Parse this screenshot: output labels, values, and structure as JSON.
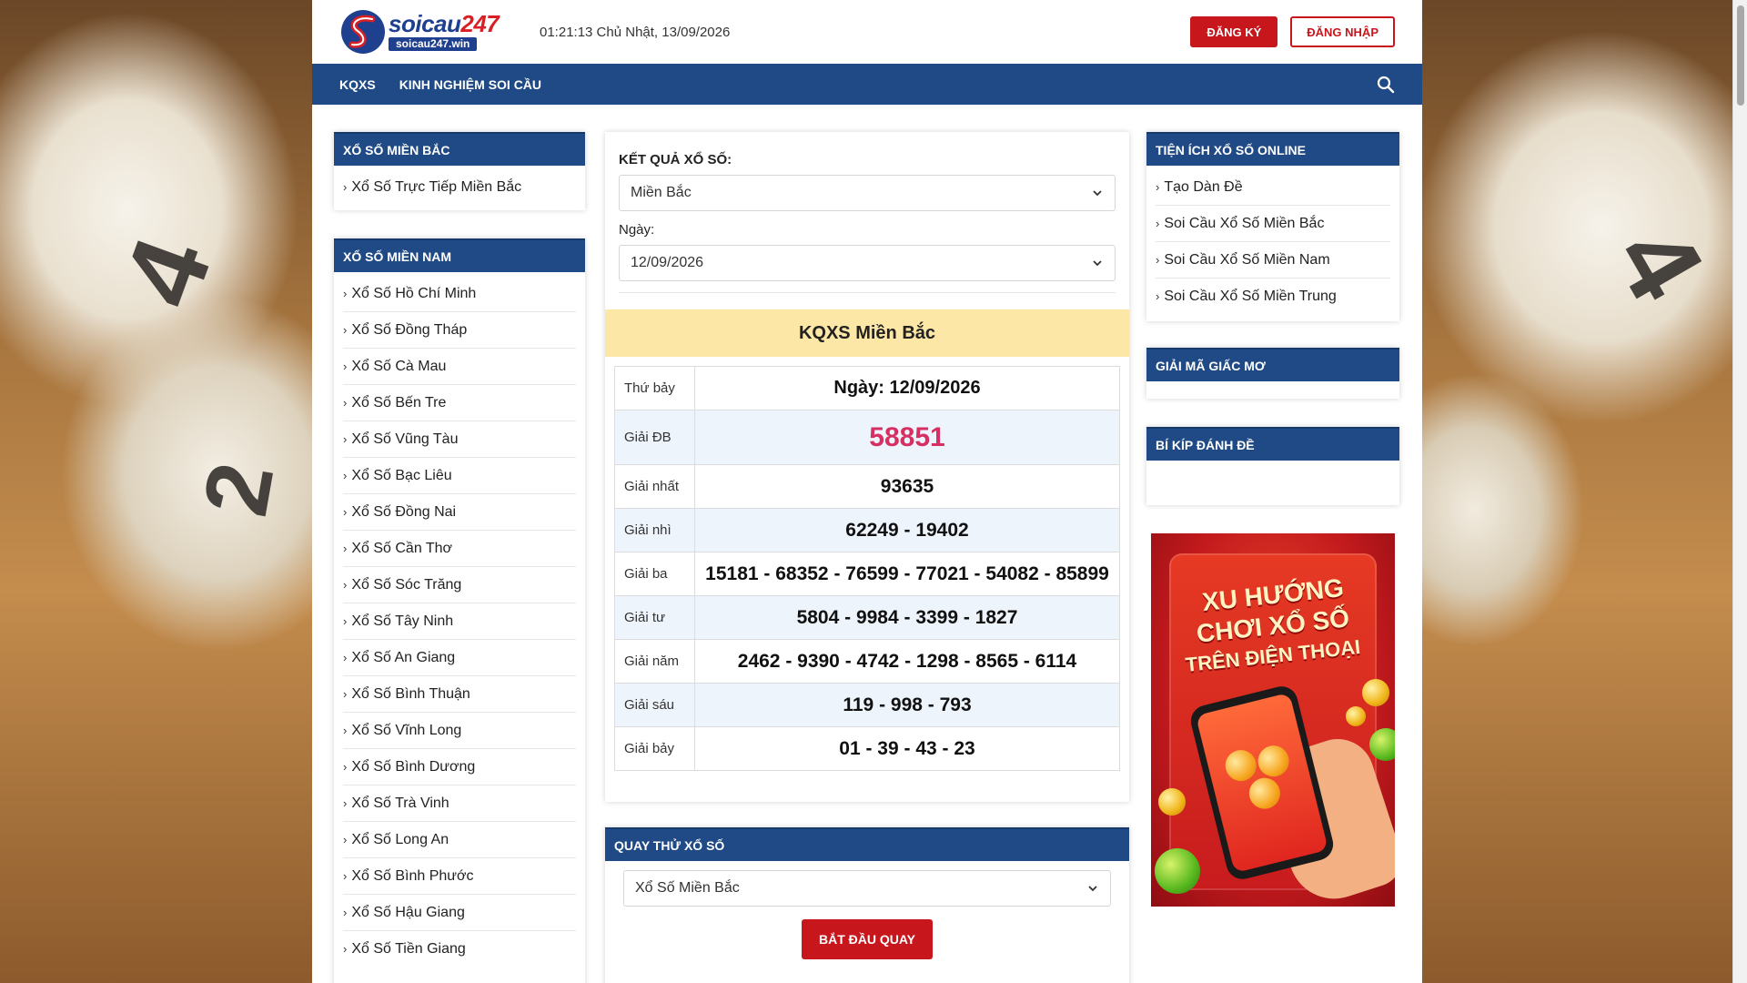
{
  "header": {
    "logo": {
      "name_part1": "soicau",
      "name_part2": "247",
      "url": "soicau247.win"
    },
    "datetime": "01:21:13 Chủ Nhật, 13/09/2026",
    "register_label": "ĐĂNG KÝ",
    "login_label": "ĐĂNG NHẬP"
  },
  "nav": {
    "items": [
      "KQXS",
      "KINH NGHIỆM SOI CẦU"
    ],
    "search_icon": "search-icon"
  },
  "left": {
    "bac": {
      "title": "XỔ SỐ MIỀN BẮC",
      "items": [
        "Xổ Số Trực Tiếp Miền Bắc"
      ]
    },
    "nam": {
      "title": "XỔ SỐ MIỀN NAM",
      "items": [
        "Xổ Số Hồ Chí Minh",
        "Xổ Số Đồng Tháp",
        "Xổ Số Cà Mau",
        "Xổ Số Bến Tre",
        "Xổ Số Vũng Tàu",
        "Xổ Số Bạc Liêu",
        "Xổ Số Đồng Nai",
        "Xổ Số Cần Thơ",
        "Xổ Số Sóc Trăng",
        "Xổ Số Tây Ninh",
        "Xổ Số An Giang",
        "Xổ Số Bình Thuận",
        "Xổ Số Vĩnh Long",
        "Xổ Số Bình Dương",
        "Xổ Số Trà Vinh",
        "Xổ Số Long An",
        "Xổ Số Bình Phước",
        "Xổ Số Hậu Giang",
        "Xổ Số Tiền Giang"
      ]
    }
  },
  "center": {
    "form": {
      "result_label": "KẾT QUẢ XỔ SỐ:",
      "region_value": "Miền Bắc",
      "date_label": "Ngày:",
      "date_value": "12/09/2026"
    },
    "result_title": "KQXS Miền Bắc",
    "table": {
      "day": "Thứ bảy",
      "date": "Ngày: 12/09/2026",
      "rows": [
        {
          "label": "Giải ĐB",
          "value": "58851"
        },
        {
          "label": "Giải nhất",
          "value": "93635"
        },
        {
          "label": "Giải nhì",
          "value": "62249 - 19402"
        },
        {
          "label": "Giải ba",
          "value": "15181 - 68352 - 76599 - 77021 - 54082 - 85899"
        },
        {
          "label": "Giải tư",
          "value": "5804 - 9984 - 3399 - 1827"
        },
        {
          "label": "Giải năm",
          "value": "2462 - 9390 - 4742 - 1298 - 8565 - 6114"
        },
        {
          "label": "Giải sáu",
          "value": "119 - 998 - 793"
        },
        {
          "label": "Giải bảy",
          "value": "01 - 39 - 43 - 23"
        }
      ]
    },
    "spin": {
      "title": "QUAY THỬ XỔ SỐ",
      "select_value": "Xổ Số Miền Bắc",
      "button_label": "BẮT ĐẦU QUAY"
    }
  },
  "right": {
    "tools": {
      "title": "TIỆN ÍCH XỔ SỐ ONLINE",
      "items": [
        "Tạo Dàn Đề",
        "Soi Cầu Xổ Số Miền Bắc",
        "Soi Cầu Xổ Số Miền Nam",
        "Soi Cầu Xổ Số Miền Trung"
      ]
    },
    "dream": {
      "title": "GIẢI MÃ GIẤC MƠ"
    },
    "tips": {
      "title": "BÍ KÍP ĐÁNH ĐỀ"
    },
    "ad": {
      "line1": "XU HƯỚNG",
      "line2": "CHƠI XỔ SỐ",
      "line3": "TRÊN ĐIỆN THOẠI"
    }
  },
  "colors": {
    "primary_blue": "#1f4a86",
    "accent_red": "#c8161d",
    "special_prize": "#d62f63",
    "result_banner": "#fde7a6"
  }
}
